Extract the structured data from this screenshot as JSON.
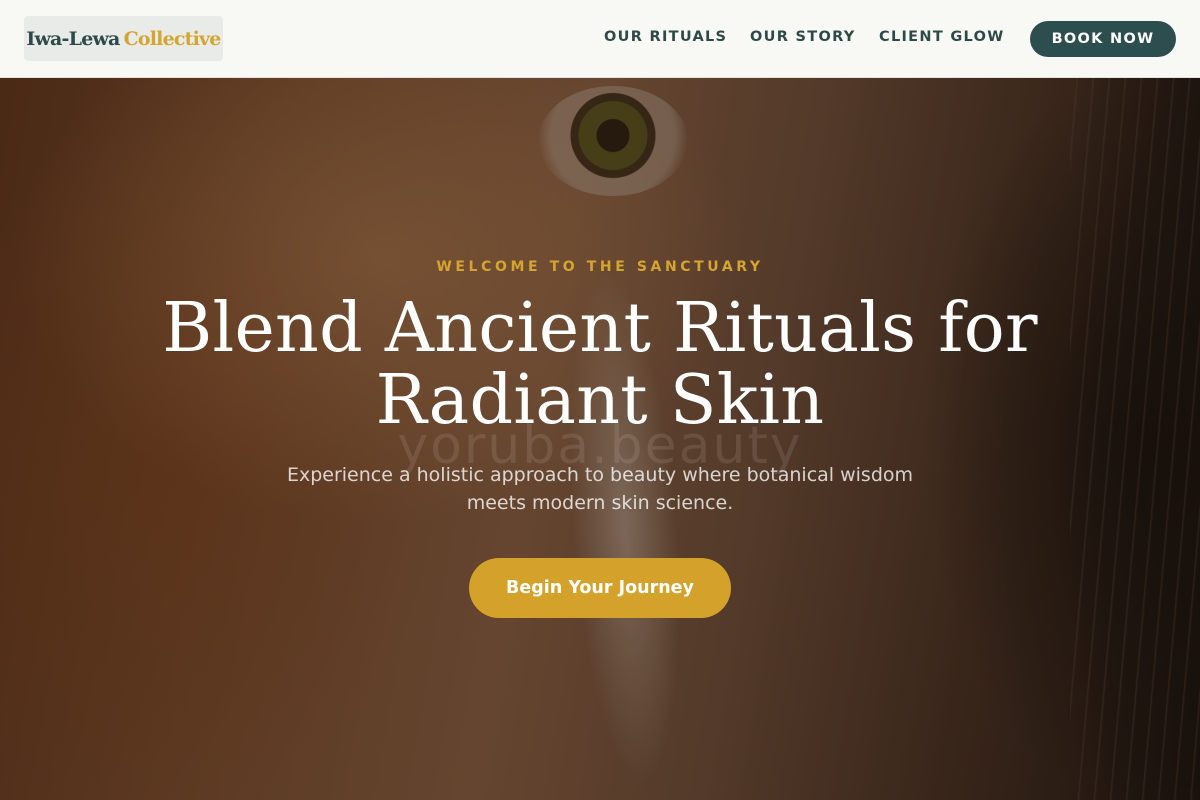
{
  "header": {
    "logo": {
      "primary": "Iwa-Lewa",
      "accent": "Collective"
    },
    "nav": [
      {
        "label": "OUR RITUALS"
      },
      {
        "label": "OUR STORY"
      },
      {
        "label": "CLIENT GLOW"
      }
    ],
    "cta_label": "BOOK NOW"
  },
  "hero": {
    "eyebrow": "WELCOME TO THE SANCTUARY",
    "headline_line1": "Blend Ancient Rituals for",
    "headline_line2": "Radiant Skin",
    "watermark": "yoruba.beauty",
    "subtext_line1": "Experience a holistic approach to beauty where botanical wisdom",
    "subtext_line2": "meets modern skin science.",
    "cta_label": "Begin Your Journey"
  },
  "colors": {
    "brand_teal": "#2d4e4f",
    "brand_gold": "#d4a531",
    "header_bg": "#f8f8f5"
  }
}
